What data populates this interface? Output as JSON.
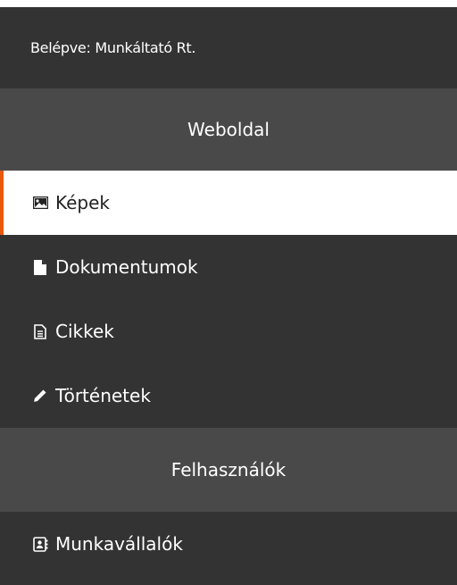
{
  "session": {
    "logged_in_text": "Belépve: Munkáltató Rt."
  },
  "sections": {
    "website": {
      "title": "Weboldal",
      "items": [
        {
          "label": "Képek",
          "icon": "image-icon",
          "active": true
        },
        {
          "label": "Dokumentumok",
          "icon": "file-icon",
          "active": false
        },
        {
          "label": "Cikkek",
          "icon": "document-text-icon",
          "active": false
        },
        {
          "label": "Történetek",
          "icon": "pencil-icon",
          "active": false
        }
      ]
    },
    "users": {
      "title": "Felhasználók",
      "items": [
        {
          "label": "Munkavállalók",
          "icon": "contact-book-icon",
          "active": false
        }
      ]
    }
  },
  "colors": {
    "sidebar_bg": "#333333",
    "section_header_bg": "#494949",
    "active_bg": "#ffffff",
    "active_accent": "#e8590c",
    "text": "#ffffff"
  }
}
